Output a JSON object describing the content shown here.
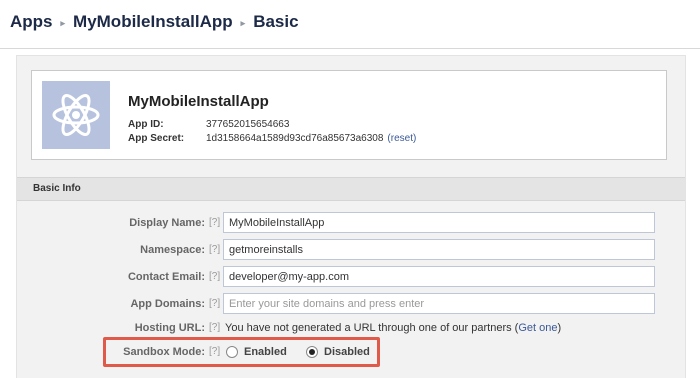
{
  "breadcrumb": {
    "items": [
      "Apps",
      "MyMobileInstallApp",
      "Basic"
    ],
    "separator": "▸"
  },
  "app": {
    "name": "MyMobileInstallApp",
    "app_id_label": "App ID:",
    "app_id": "377652015654663",
    "app_secret_label": "App Secret:",
    "app_secret": "1d3158664a1589d93cd76a85673a6308",
    "reset_label": "(reset)",
    "icon": "atom-icon"
  },
  "basic_info": {
    "section_title": "Basic Info",
    "help_marker": "[?]",
    "display_name": {
      "label": "Display Name:",
      "value": "MyMobileInstallApp"
    },
    "namespace": {
      "label": "Namespace:",
      "value": "getmoreinstalls"
    },
    "contact_email": {
      "label": "Contact Email:",
      "value": "developer@my-app.com"
    },
    "app_domains": {
      "label": "App Domains:",
      "placeholder": "Enter your site domains and press enter"
    },
    "hosting_url": {
      "label": "Hosting URL:",
      "text": "You have not generated a URL through one of our partners (",
      "link": "Get one",
      "suffix": ")"
    },
    "sandbox_mode": {
      "label": "Sandbox Mode:",
      "options": [
        "Enabled",
        "Disabled"
      ],
      "selected": "Disabled"
    }
  },
  "colors": {
    "link": "#3b5998",
    "highlight": "#e05a4a",
    "icon_bg": "#b7c3de"
  }
}
